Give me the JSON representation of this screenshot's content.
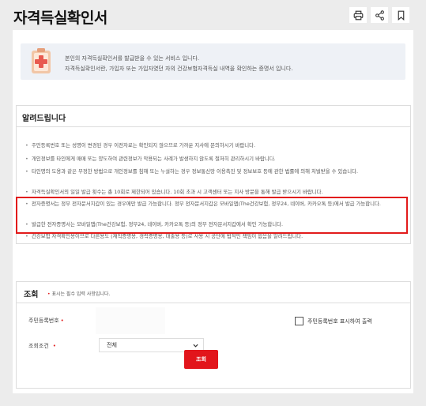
{
  "header": {
    "title": "자격득실확인서"
  },
  "toolbar": {
    "icons": [
      "print-icon",
      "share-icon",
      "bookmark-icon"
    ]
  },
  "intro": {
    "line1": "본인의 자격득실확인서를 발급받을 수 있는 서비스 입니다.",
    "line2": "자격득실확인서란, 가입자 또는 가입자였던 자의 건강보험자격득실 내역을 확인하는 증명서 입니다."
  },
  "notice": {
    "title": "알려드립니다",
    "items": [
      "주민등록번호 또는 성명이 변경된 경우 이전자료는 확인되지 않으므로 가까운 지사에 문의하시기 바랍니다.",
      "개인정보를 타인에게 매매 또는 양도하여 관련정보가 악용되는 사례가 발생하지 않도록 철저히 관리하시기 바랍니다.",
      "타인명의 도용과 같은 부정한 방법으로 개인정보를 침해 또는 누설하는 경우 정보통신망 이용촉진 및 정보보호 등에 관한 법률에 의해 처벌받을 수 있습니다.",
      "자격득실확인서의 일일 발급 횟수는 총 10회로 제한되어 있습니다. 10회 초과 시 고객센터 또는 지사 방문을 통해 발급 받으시기 바랍니다.",
      "전자증명서는 정부 전자문서지갑이 있는 경우에만 발급 가능합니다. 정부 전자문서지갑은 모바일앱(The건강보험, 정부24, 네이버, 카카오톡 등)에서 발급 가능합니다.",
      "발급한 전자증명서는 모바일앱(The건강보험, 정부24, 네이버, 카카오톡 등)의 정부 전자문서지갑에서 확인 가능합니다.",
      "건강보험 자격확인용이므로 다른용도 (재직증명용, 경력증명용, 대출용 등)로 사용 시 공단에 법적인 책임이 없음을 알려드립니다."
    ]
  },
  "query": {
    "title": "조회",
    "required_note": "표시는 필수 입력 사항입니다.",
    "required_mark": "•",
    "rrn_label": "주민등록번호",
    "rrn_value": "",
    "show_rrn_label": "주민등록번호 표시하여 출력",
    "condition_label": "조회조건",
    "condition_value": "전체"
  },
  "actions": {
    "submit_label": "조회"
  },
  "colors": {
    "accent": "#e2151b",
    "highlight": "#e21b1b",
    "intro_bg": "#eef1f6",
    "page_bg": "#ececec"
  }
}
